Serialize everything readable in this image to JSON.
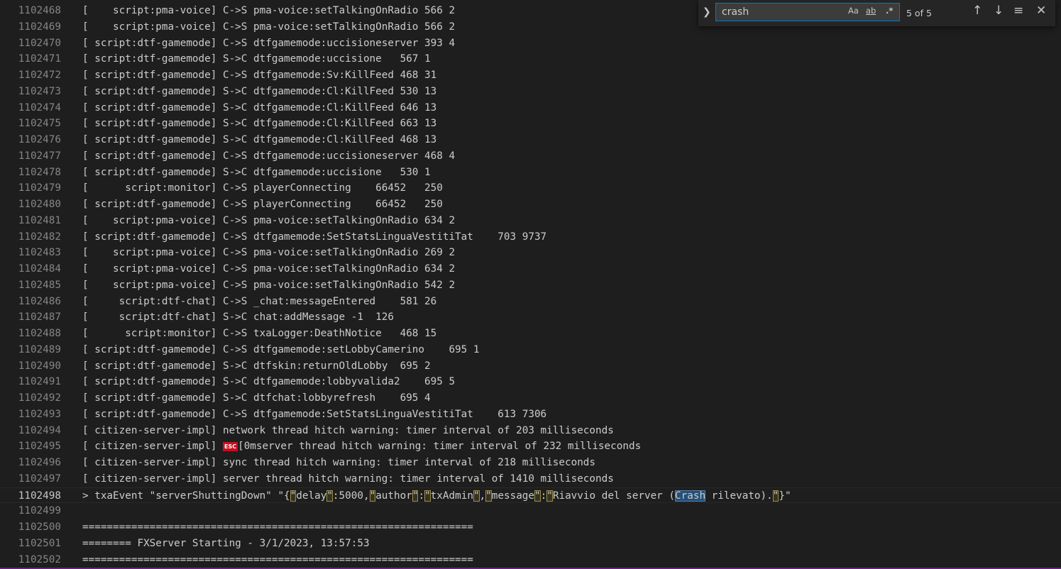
{
  "find": {
    "query": "crash",
    "count": "5 of 5",
    "match_case_label": "Aa",
    "whole_word_label": "ab",
    "regex_label": ".*",
    "toggle_icon": "chevron-right-icon",
    "prev_icon": "arrow-up-icon",
    "next_icon": "arrow-down-icon",
    "selection_icon": "find-in-selection-icon",
    "close_icon": "close-icon"
  },
  "lines": [
    {
      "n": "1102468",
      "text": "[    script:pma-voice] C->S pma-voice:setTalkingOnRadio 566 2"
    },
    {
      "n": "1102469",
      "text": "[    script:pma-voice] C->S pma-voice:setTalkingOnRadio 566 2"
    },
    {
      "n": "1102470",
      "text": "[ script:dtf-gamemode] C->S dtfgamemode:uccisioneserver 393 4"
    },
    {
      "n": "1102471",
      "text": "[ script:dtf-gamemode] S->C dtfgamemode:uccisione   567 1"
    },
    {
      "n": "1102472",
      "text": "[ script:dtf-gamemode] C->S dtfgamemode:Sv:KillFeed 468 31"
    },
    {
      "n": "1102473",
      "text": "[ script:dtf-gamemode] S->C dtfgamemode:Cl:KillFeed 530 13"
    },
    {
      "n": "1102474",
      "text": "[ script:dtf-gamemode] S->C dtfgamemode:Cl:KillFeed 646 13"
    },
    {
      "n": "1102475",
      "text": "[ script:dtf-gamemode] S->C dtfgamemode:Cl:KillFeed 663 13"
    },
    {
      "n": "1102476",
      "text": "[ script:dtf-gamemode] S->C dtfgamemode:Cl:KillFeed 468 13"
    },
    {
      "n": "1102477",
      "text": "[ script:dtf-gamemode] C->S dtfgamemode:uccisioneserver 468 4"
    },
    {
      "n": "1102478",
      "text": "[ script:dtf-gamemode] S->C dtfgamemode:uccisione   530 1"
    },
    {
      "n": "1102479",
      "text": "[      script:monitor] C->S playerConnecting    66452   250"
    },
    {
      "n": "1102480",
      "text": "[ script:dtf-gamemode] C->S playerConnecting    66452   250"
    },
    {
      "n": "1102481",
      "text": "[    script:pma-voice] C->S pma-voice:setTalkingOnRadio 634 2"
    },
    {
      "n": "1102482",
      "text": "[ script:dtf-gamemode] C->S dtfgamemode:SetStatsLinguaVestitiTat    703 9737"
    },
    {
      "n": "1102483",
      "text": "[    script:pma-voice] C->S pma-voice:setTalkingOnRadio 269 2"
    },
    {
      "n": "1102484",
      "text": "[    script:pma-voice] C->S pma-voice:setTalkingOnRadio 634 2"
    },
    {
      "n": "1102485",
      "text": "[    script:pma-voice] C->S pma-voice:setTalkingOnRadio 542 2"
    },
    {
      "n": "1102486",
      "text": "[     script:dtf-chat] C->S _chat:messageEntered    581 26"
    },
    {
      "n": "1102487",
      "text": "[     script:dtf-chat] S->C chat:addMessage -1  126"
    },
    {
      "n": "1102488",
      "text": "[      script:monitor] C->S txaLogger:DeathNotice   468 15"
    },
    {
      "n": "1102489",
      "text": "[ script:dtf-gamemode] C->S dtfgamemode:setLobbyCamerino    695 1"
    },
    {
      "n": "1102490",
      "text": "[ script:dtf-gamemode] S->C dtfskin:returnOldLobby  695 2"
    },
    {
      "n": "1102491",
      "text": "[ script:dtf-gamemode] S->C dtfgamemode:lobbyvalida2    695 5"
    },
    {
      "n": "1102492",
      "text": "[ script:dtf-gamemode] S->C dtfchat:lobbyrefresh    695 4"
    },
    {
      "n": "1102493",
      "text": "[ script:dtf-gamemode] C->S dtfgamemode:SetStatsLinguaVestitiTat    613 7306"
    },
    {
      "n": "1102494",
      "text": "[ citizen-server-impl] network thread hitch warning: timer interval of 203 milliseconds"
    },
    {
      "n": "1102495",
      "text": "[ citizen-server-impl] ",
      "esc": "ESC",
      "after": "[0mserver thread hitch warning: timer interval of 232 milliseconds"
    },
    {
      "n": "1102496",
      "text": "[ citizen-server-impl] sync thread hitch warning: timer interval of 218 milliseconds"
    },
    {
      "n": "1102497",
      "text": "[ citizen-server-impl] server thread hitch warning: timer interval of 1410 milliseconds"
    },
    {
      "n": "1102498",
      "active": true,
      "parts": [
        {
          "t": "> txaEvent \"serverShuttingDown\" \"{"
        },
        {
          "t": "\"",
          "hl": true
        },
        {
          "t": "delay"
        },
        {
          "t": "\"",
          "hl": true
        },
        {
          "t": ":5000,"
        },
        {
          "t": "\"",
          "hl": true
        },
        {
          "t": "author"
        },
        {
          "t": "\"",
          "hl": true
        },
        {
          "t": ":"
        },
        {
          "t": "\"",
          "hl": true
        },
        {
          "t": "txAdmin"
        },
        {
          "t": "\"",
          "hl": true
        },
        {
          "t": ","
        },
        {
          "t": "\"",
          "hl": true
        },
        {
          "t": "message"
        },
        {
          "t": "\"",
          "hl": true
        },
        {
          "t": ":"
        },
        {
          "t": "\"",
          "hl": true
        },
        {
          "t": "Riavvio del server ("
        },
        {
          "t": "Crash",
          "cur": true
        },
        {
          "t": " rilevato)."
        },
        {
          "t": "\"",
          "hl": true
        },
        {
          "t": "}\""
        }
      ]
    },
    {
      "n": "1102499",
      "text": ""
    },
    {
      "n": "1102500",
      "text": "================================================================"
    },
    {
      "n": "1102501",
      "text": "======== FXServer Starting - 3/1/2023, 13:57:53"
    },
    {
      "n": "1102502",
      "text": "================================================================"
    }
  ]
}
